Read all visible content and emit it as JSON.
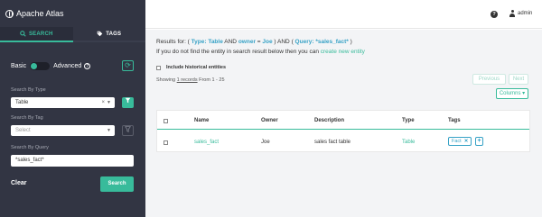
{
  "app": {
    "title": "Apache Atlas"
  },
  "sidebar": {
    "tabs": [
      {
        "label": "SEARCH",
        "icon": "search-icon",
        "active": true
      },
      {
        "label": "TAGS",
        "icon": "tag-icon",
        "active": false
      }
    ],
    "mode": {
      "basic_label": "Basic",
      "advanced_label": "Advanced",
      "selected": "Basic"
    },
    "search_by_type": {
      "label": "Search By Type",
      "value": "Table"
    },
    "search_by_tag": {
      "label": "Search By Tag",
      "placeholder": "Select"
    },
    "search_by_query": {
      "label": "Search By Query",
      "value": "*sales_fact*"
    },
    "clear_label": "Clear",
    "search_button": "Search"
  },
  "header": {
    "user": "admin"
  },
  "results": {
    "prefix": "Results for:",
    "type_key": "Type:",
    "type_value": "Table",
    "and1": "AND",
    "owner_key": "owner",
    "owner_op": "=",
    "owner_value": "Joe",
    "and2": "AND",
    "query_key": "Query:",
    "query_value": "*sales_fact*",
    "notfound_text": "If you do not find the entity in search result below then you can",
    "create_link": "create new entity",
    "historical_label": "Include historical entities",
    "showing_prefix": "Showing",
    "showing_count": "1 records",
    "showing_suffix": "From 1 - 25",
    "prev_label": "Previous",
    "next_label": "Next",
    "columns_label": "Columns"
  },
  "table": {
    "headers": [
      "Name",
      "Owner",
      "Description",
      "Type",
      "Tags"
    ],
    "rows": [
      {
        "name": "sales_fact",
        "owner": "Joe",
        "description": "sales fact table",
        "type": "Table",
        "tags": [
          "Fact"
        ]
      }
    ]
  },
  "colors": {
    "sidebar_bg": "#323543",
    "accent": "#38bb9b",
    "link_blue": "#37a2c6",
    "main_bg": "#f3f4f6"
  }
}
